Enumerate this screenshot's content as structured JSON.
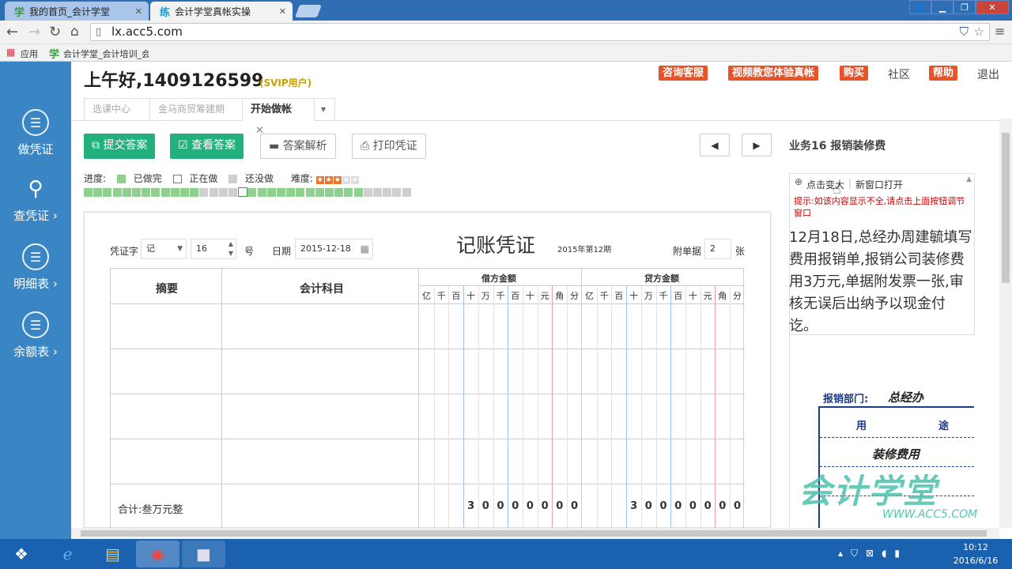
{
  "browser": {
    "tabs": [
      {
        "icon": "学",
        "label": "我的首页_会计学堂",
        "close": "✕"
      },
      {
        "icon": "练",
        "label": "会计学堂真帐实操",
        "close": "✕"
      }
    ],
    "url": "lx.acc5.com",
    "bookmarks": [
      {
        "label": "应用"
      },
      {
        "icon": "学",
        "label": "会计学堂_会计培训_会"
      }
    ]
  },
  "sidebar": {
    "items": [
      {
        "label": "做凭证",
        "icon": "document-icon"
      },
      {
        "label": "查凭证 ›",
        "icon": "search-icon"
      },
      {
        "label": "明细表 ›",
        "icon": "list-icon"
      },
      {
        "label": "余额表 ›",
        "icon": "list-icon"
      }
    ]
  },
  "header": {
    "greeting": "上午好,1409126599",
    "user_type": "(SVIP用户)",
    "buttons": [
      "咨询客服",
      "视频教您体验真帐",
      "购买",
      "帮助"
    ],
    "links": [
      "社区",
      "退出"
    ]
  },
  "page_tabs": [
    {
      "label": "选课中心"
    },
    {
      "label": "金马商贸筹建期"
    },
    {
      "label": "开始做帐",
      "close": "✕"
    }
  ],
  "toolbar": {
    "submit": "提交答案",
    "view_answer": "查看答案",
    "analysis": "答案解析",
    "print": "打印凭证"
  },
  "progress": {
    "label": "进度:",
    "done_label": "已做完",
    "doing_label": "正在做",
    "todo_label": "还没做",
    "difficulty_label": "难度:",
    "difficulty_stars": 3,
    "difficulty_max": 5,
    "total": 34,
    "done_count": 13,
    "current_index": 16,
    "done_indices": [
      0,
      1,
      2,
      3,
      4,
      5,
      6,
      7,
      8,
      9,
      10,
      11,
      17,
      18,
      19,
      20,
      21,
      22,
      23,
      24,
      25,
      26,
      27,
      28
    ],
    "colors": {
      "done": "#8fd08f",
      "todo": "#cfcfcf",
      "doing": "#ffffff"
    }
  },
  "voucher": {
    "title": "记账凭证",
    "period": "2015年第12期",
    "type_label": "凭证字",
    "type_value": "记",
    "number_value": "16",
    "number_unit": "号",
    "date_label": "日期",
    "date_value": "2015-12-18",
    "attach_label": "附单据",
    "attach_value": "2",
    "attach_unit": "张",
    "col_summary": "摘要",
    "col_account": "会计科目",
    "debit_header": "借方金额",
    "credit_header": "贷方金额",
    "digit_headers": [
      "亿",
      "千",
      "百",
      "十",
      "万",
      "千",
      "百",
      "十",
      "元",
      "角",
      "分"
    ],
    "total_label": "合计:叁万元整",
    "debit_total_digits": [
      "",
      "",
      "",
      "3",
      "0",
      "0",
      "0",
      "0",
      "0",
      "0",
      "0"
    ],
    "credit_total_digits": [
      "",
      "",
      "",
      "3",
      "0",
      "0",
      "0",
      "0",
      "0",
      "0",
      "0"
    ]
  },
  "right_panel": {
    "title": "业务16 报销装修费",
    "zoom_link": "点击变大",
    "new_window": "新窗口打开",
    "hint": "提示:如该内容显示不全,请点击上面按钮调节窗口",
    "description": "12月18日,总经办周建毓填写费用报销单,报销公司装修费用3万元,单据附发票一张,审核无误后出纳予以现金付讫。",
    "form_dept_label": "报销部门:",
    "form_dept_value": "总经办",
    "form_col_use": "用",
    "form_col_use2": "途",
    "form_row1": "装修费用",
    "watermark": "会计学堂",
    "watermark_url": "WWW.ACC5.COM"
  },
  "taskbar": {
    "time": "10:12",
    "date": "2016/6/16"
  }
}
